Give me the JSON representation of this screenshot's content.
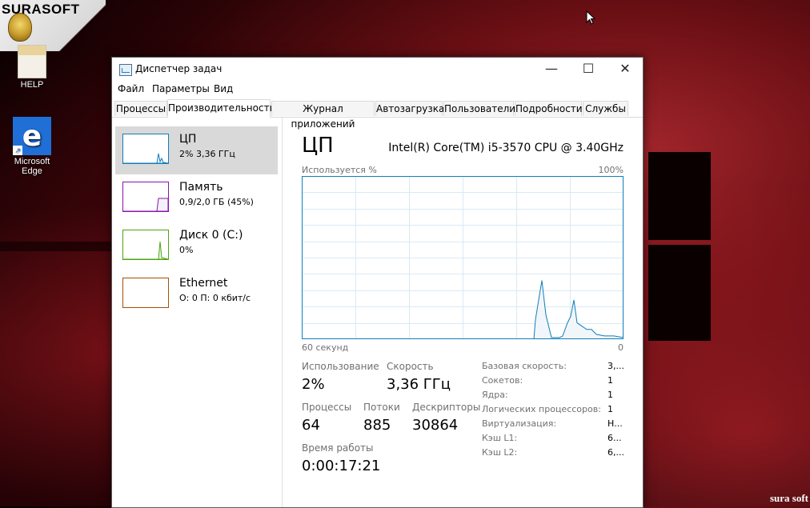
{
  "desktop": {
    "watermark": "SURASOFT",
    "corner_text": "sura soft",
    "icons": [
      {
        "label": "HELP",
        "icon": "folder-document-icon"
      },
      {
        "label": "Microsoft Edge",
        "icon": "edge-icon"
      }
    ]
  },
  "window": {
    "title": "Диспетчер задач",
    "controls": {
      "minimize": "—",
      "maximize": "☐",
      "close": "✕"
    },
    "menu": [
      "Файл",
      "Параметры",
      "Вид"
    ],
    "tabs": [
      "Процессы",
      "Производительность",
      "Журнал приложений",
      "Автозагрузка",
      "Пользователи",
      "Подробности",
      "Службы"
    ],
    "active_tab": "Производительность"
  },
  "resources": [
    {
      "name": "ЦП",
      "sub": "2% 3,36 ГГц",
      "color": "#117dbb"
    },
    {
      "name": "Память",
      "sub": "0,9/2,0 ГБ (45%)",
      "color": "#8b12ae"
    },
    {
      "name": "Диск 0 (C:)",
      "sub": "0%",
      "color": "#4da60c"
    },
    {
      "name": "Ethernet",
      "sub": "О: 0 П: 0 кбит/с",
      "color": "#a74f01"
    }
  ],
  "cpu": {
    "title": "ЦП",
    "model": "Intel(R) Core(TM) i5-3570 CPU @ 3.40GHz",
    "graph": {
      "label_top_left": "Используется %",
      "label_top_right": "100%",
      "label_bottom_left": "60 секунд",
      "label_bottom_right": "0",
      "line_color": "#117dbb",
      "fill_color": "#f1f6fa",
      "grid_color": "#d9eaf4",
      "usage_percent": [
        0,
        0,
        0,
        0,
        0,
        0,
        0,
        0,
        0,
        0,
        0,
        0,
        0,
        0,
        0,
        0,
        0,
        0,
        0,
        0,
        0,
        0,
        0,
        0,
        0,
        0,
        0,
        0,
        0,
        0,
        0,
        0,
        0,
        0,
        0,
        0,
        0,
        0,
        0,
        0,
        0,
        0,
        0,
        0,
        0,
        0,
        0,
        0,
        0,
        0,
        0,
        0,
        0,
        0,
        0,
        0,
        0,
        0,
        0,
        0,
        0,
        0,
        0,
        0,
        0,
        0,
        0,
        0,
        0,
        0,
        0,
        0,
        0,
        0,
        0,
        0,
        0,
        0,
        0,
        0,
        0,
        0,
        0,
        0,
        0,
        0,
        0,
        0,
        0,
        0,
        0,
        0,
        0,
        0,
        0,
        0,
        0,
        0,
        0,
        0,
        0,
        0,
        0,
        0,
        0,
        0,
        0,
        0,
        0,
        0,
        0,
        0,
        0,
        0,
        0,
        0,
        0,
        0,
        0,
        0,
        0,
        0,
        0,
        0,
        0,
        0,
        0,
        0,
        0,
        0,
        0,
        0,
        0,
        0,
        0,
        0,
        0,
        0,
        0,
        0,
        0,
        0,
        0,
        0,
        0,
        0,
        0,
        0,
        0,
        0,
        0,
        0,
        0,
        0,
        0,
        0,
        0,
        0,
        0,
        0,
        0,
        0,
        0,
        0,
        0,
        0,
        0,
        0,
        0,
        0,
        0,
        0,
        0,
        0,
        0,
        0,
        0,
        0,
        0,
        0,
        0,
        0,
        0,
        0,
        0,
        0,
        0,
        0,
        0,
        0,
        0,
        0,
        0,
        0,
        0,
        0,
        0,
        0,
        0,
        0,
        0,
        0,
        0,
        0,
        0,
        0,
        0,
        0,
        0,
        0,
        0,
        0,
        0,
        0,
        0,
        0,
        0,
        0,
        0,
        0,
        0,
        0,
        0,
        0,
        0,
        0,
        0,
        0,
        0,
        0,
        0,
        0,
        0,
        0,
        0,
        0,
        0,
        0,
        0,
        0,
        0,
        0,
        0,
        0,
        0,
        0,
        0,
        0,
        0,
        0,
        0,
        0,
        0,
        0,
        0,
        0,
        0,
        0,
        0,
        0,
        0,
        0,
        0,
        0,
        0,
        0,
        0,
        0,
        0,
        0,
        0,
        0,
        0,
        0,
        0,
        0,
        0,
        0,
        0,
        0,
        0,
        0,
        0,
        0,
        0,
        0,
        0,
        0,
        0,
        0,
        0,
        0,
        0,
        0,
        0,
        0,
        0,
        0,
        0,
        0,
        0,
        0,
        0,
        0,
        0,
        0,
        0,
        0,
        0,
        0,
        0,
        0,
        0,
        0,
        0,
        0,
        0,
        0,
        0,
        0,
        0,
        0,
        0,
        0,
        0,
        0,
        0,
        0,
        0,
        0,
        0,
        0,
        0,
        0,
        0,
        0,
        0,
        0,
        0,
        0,
        0,
        0,
        0,
        0,
        0,
        0,
        0,
        0,
        0,
        0,
        0,
        0,
        0,
        0,
        0,
        0,
        0,
        0,
        0,
        0,
        0,
        0,
        0,
        0,
        0,
        0,
        0,
        0,
        0,
        0,
        0,
        0,
        0,
        0,
        0,
        0,
        0,
        0,
        0,
        0,
        0,
        0,
        0,
        0,
        0,
        0,
        0,
        0,
        0,
        0,
        0,
        0,
        0,
        0,
        0,
        0,
        0,
        0,
        0,
        0,
        0,
        0,
        0,
        0,
        0,
        0,
        0,
        0,
        0,
        0,
        0,
        0,
        0,
        0,
        0,
        0,
        0,
        0,
        0,
        0,
        0,
        0,
        0,
        0,
        0,
        0,
        0,
        0,
        0,
        0,
        0,
        0,
        0,
        0,
        0,
        0,
        0,
        0,
        0,
        0,
        0,
        0,
        0,
        0,
        0
      ]
    },
    "stats": [
      {
        "label": "Использование",
        "value": "2%"
      },
      {
        "label": "Скорость",
        "value": "3,36 ГГц"
      },
      {
        "label": "Процессы",
        "value": "64"
      },
      {
        "label": "Потоки",
        "value": "885"
      },
      {
        "label": "Дескрипторы",
        "value": "30864"
      },
      {
        "label": "Время работы",
        "value": "0:00:17:21"
      }
    ],
    "specs": [
      {
        "label": "Базовая скорость:",
        "value": "3,..."
      },
      {
        "label": "Сокетов:",
        "value": "1"
      },
      {
        "label": "Ядра:",
        "value": "1"
      },
      {
        "label": "Логических процессоров:",
        "value": "1"
      },
      {
        "label": "Виртуализация:",
        "value": "Н..."
      },
      {
        "label": "Кэш L1:",
        "value": "6..."
      },
      {
        "label": "Кэш L2:",
        "value": "6,..."
      }
    ]
  }
}
